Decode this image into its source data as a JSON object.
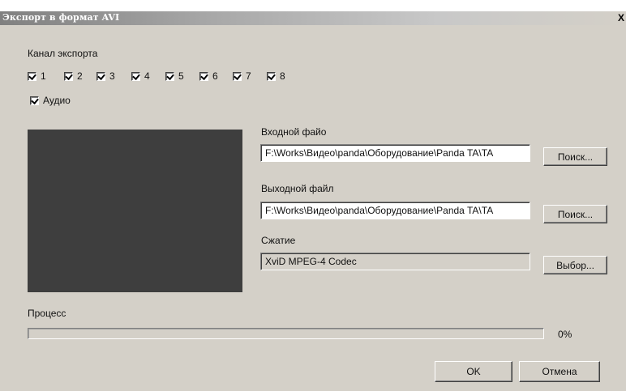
{
  "window": {
    "title": "Экспорт в формат AVI",
    "close_label": "X"
  },
  "export_channel": {
    "label": "Канал экспорта",
    "channels": [
      {
        "label": "1",
        "checked": true
      },
      {
        "label": "2",
        "checked": true
      },
      {
        "label": "3",
        "checked": true
      },
      {
        "label": "4",
        "checked": true
      },
      {
        "label": "5",
        "checked": true
      },
      {
        "label": "6",
        "checked": true
      },
      {
        "label": "7",
        "checked": true
      },
      {
        "label": "8",
        "checked": true
      }
    ],
    "audio": {
      "label": "Аудио",
      "checked": true
    }
  },
  "input_file": {
    "label": "Входной файо",
    "value": "F:\\Works\\Видео\\panda\\Оборудование\\Panda TA\\TA",
    "button": "Поиск..."
  },
  "output_file": {
    "label": "Выходной файл",
    "value": "F:\\Works\\Видео\\panda\\Оборудование\\Panda TA\\TA",
    "button": "Поиск..."
  },
  "compression": {
    "label": "Сжатие",
    "value": "XviD MPEG-4 Codec",
    "button": "Выбор..."
  },
  "process": {
    "label": "Процесс",
    "progress_percent": 0,
    "progress_text": "0%"
  },
  "actions": {
    "ok": "OK",
    "cancel": "Отмена"
  }
}
